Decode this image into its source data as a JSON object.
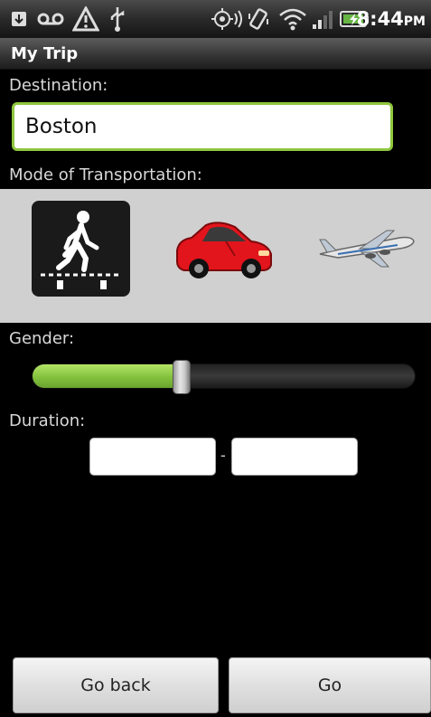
{
  "statusbar": {
    "time": "8:44",
    "ampm": "PM",
    "icons": [
      "download-icon",
      "voicemail-icon",
      "warning-icon",
      "usb-icon",
      "gps-icon",
      "vibrate-icon",
      "wifi-icon",
      "signal-icon",
      "battery-icon"
    ]
  },
  "titlebar": {
    "title": "My Trip"
  },
  "destination": {
    "label": "Destination:",
    "value": "Boston"
  },
  "transport": {
    "label": "Mode of Transportation:",
    "options": [
      "walk",
      "car",
      "plane"
    ],
    "selected": "walk"
  },
  "gender": {
    "label": "Gender:",
    "slider_value": 0.39
  },
  "duration": {
    "label": "Duration:",
    "separator": "-",
    "start_value": "",
    "end_value": ""
  },
  "buttons": {
    "back_label": "Go back",
    "go_label": "Go"
  },
  "colors": {
    "accent": "#8ec63f",
    "selected_bg": "#1a1a1a",
    "panel_bg": "#d0d0d0"
  }
}
